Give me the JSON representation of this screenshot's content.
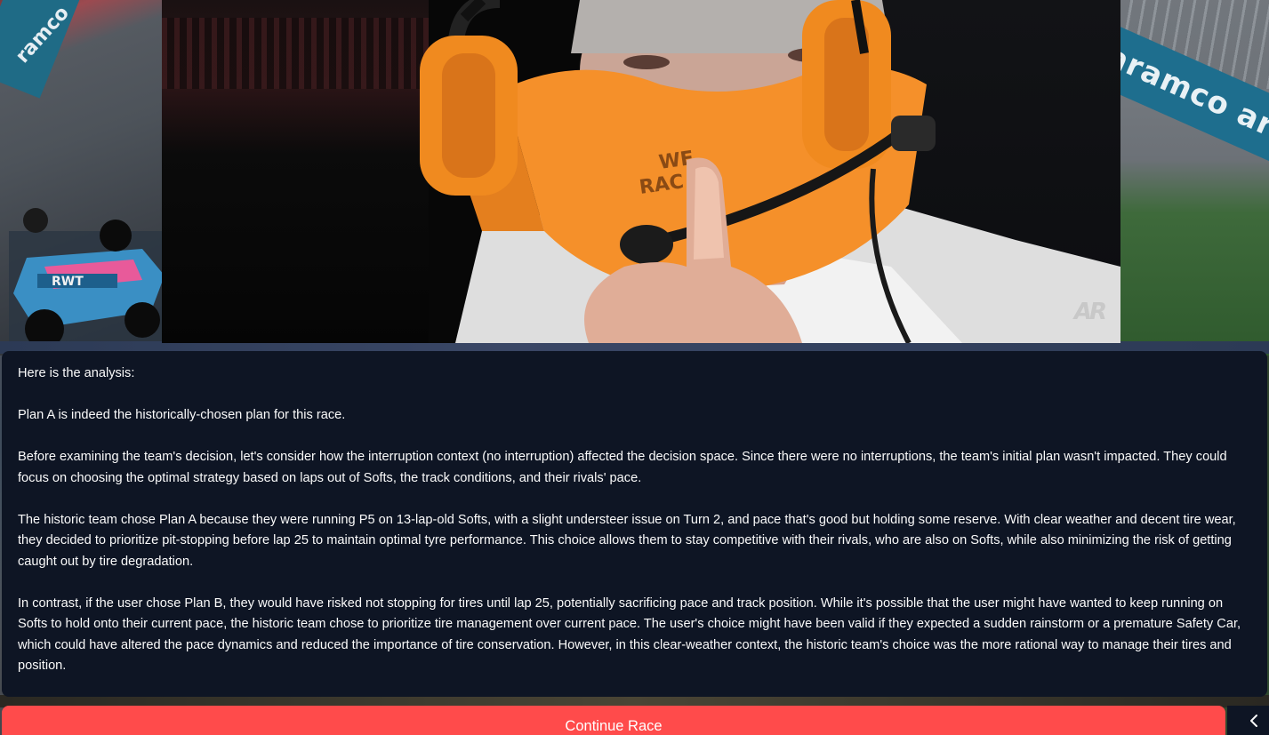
{
  "media": {
    "logo_text": "AR",
    "left_banner_text": "ramco",
    "right_banner_text": "aramco aramco"
  },
  "analysis": {
    "paragraphs": [
      "Here is the analysis:",
      "Plan A is indeed the historically-chosen plan for this race.",
      "Before examining the team's decision, let's consider how the interruption context (no interruption) affected the decision space. Since there were no interruptions, the team's initial plan wasn't impacted. They could focus on choosing the optimal strategy based on laps out of Softs, the track conditions, and their rivals' pace.",
      "The historic team chose Plan A because they were running P5 on 13-lap-old Softs, with a slight understeer issue on Turn 2, and pace that's good but holding some reserve. With clear weather and decent tire wear, they decided to prioritize pit-stopping before lap 25 to maintain optimal tyre performance. This choice allows them to stay competitive with their rivals, who are also on Softs, while also minimizing the risk of getting caught out by tire degradation.",
      "In contrast, if the user chose Plan B, they would have risked not stopping for tires until lap 25, potentially sacrificing pace and track position. While it's possible that the user might have wanted to keep running on Softs to hold onto their current pace, the historic team chose to prioritize tire management over current pace. The user's choice might have been valid if they expected a sudden rainstorm or a premature Safety Car, which could have altered the pace dynamics and reduced the importance of tire conservation. However, in this clear-weather context, the historic team's choice was the more rational way to manage their tires and position."
    ]
  },
  "actions": {
    "continue_label": "Continue Race",
    "collapse_icon": "chevron-left-icon"
  },
  "colors": {
    "primary_button": "#ff4b4b",
    "panel_bg": "#0e1524",
    "text": "#fafafa",
    "mask_orange": "#f5902a"
  }
}
